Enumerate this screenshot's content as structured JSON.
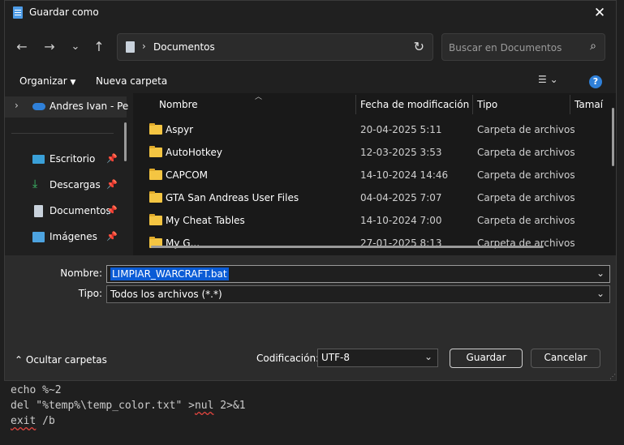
{
  "dialog": {
    "title": "Guardar como",
    "close_label": "✕",
    "nav": {
      "back": "←",
      "forward": "→",
      "recent": "⌄",
      "up": "↑"
    },
    "address": {
      "chevron": "›",
      "path": "Documentos",
      "refresh": "↻"
    },
    "search": {
      "placeholder": "Buscar en Documentos",
      "icon": "⌕"
    },
    "commands": {
      "organize": "Organizar",
      "new_folder": "Nueva carpeta",
      "view": "☰ ⌄",
      "help": "?"
    },
    "nav_pane": {
      "items": [
        {
          "label": "Andres Ivan - Pe",
          "icon": "onedrive-icon",
          "expander": "›"
        },
        {
          "label": "Escritorio",
          "icon": "desktop-icon",
          "pinned": true
        },
        {
          "label": "Descargas",
          "icon": "download-icon",
          "pinned": true
        },
        {
          "label": "Documentos",
          "icon": "document-icon",
          "pinned": true
        },
        {
          "label": "Imágenes",
          "icon": "pictures-icon",
          "pinned": true
        }
      ]
    },
    "columns": {
      "name": "Nombre",
      "date": "Fecha de modificación",
      "type": "Tipo",
      "size": "Tamaí"
    },
    "files": [
      {
        "name": "Aspyr",
        "date": "20-04-2025 5:11",
        "type": "Carpeta de archivos"
      },
      {
        "name": "AutoHotkey",
        "date": "12-03-2025 3:53",
        "type": "Carpeta de archivos"
      },
      {
        "name": "CAPCOM",
        "date": "14-10-2024 14:46",
        "type": "Carpeta de archivos"
      },
      {
        "name": "GTA San Andreas User Files",
        "date": "04-04-2025 7:07",
        "type": "Carpeta de archivos"
      },
      {
        "name": "My Cheat Tables",
        "date": "14-10-2024 7:00",
        "type": "Carpeta de archivos"
      },
      {
        "name": "My G...",
        "date": "27-01-2025 8:13",
        "type": "Carpeta de archivos"
      }
    ],
    "filename_label": "Nombre:",
    "filename_value": "LIMPIAR_WARCRAFT.bat",
    "filetype_label": "Tipo:",
    "filetype_value": "Todos los archivos  (*.*)",
    "hide_folders": "Ocultar carpetas",
    "encoding_label": "Codificación:",
    "encoding_value": "UTF-8",
    "save_label": "Guardar",
    "cancel_label": "Cancelar"
  },
  "editor": {
    "lines": [
      "echo %~2",
      "del \"%temp%\\temp_color.txt\" >nul 2>&1",
      "exit /b"
    ]
  }
}
